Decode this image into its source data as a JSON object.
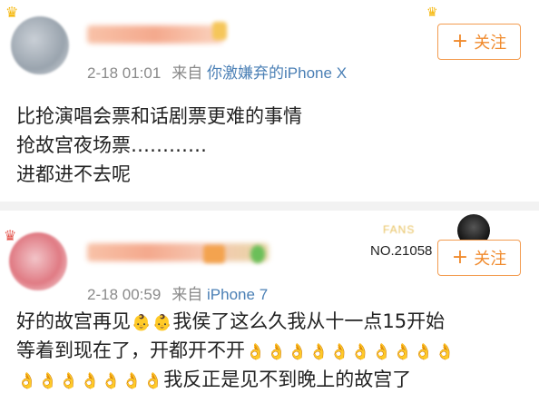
{
  "posts": [
    {
      "timestamp": "2-18 01:01",
      "source_prefix": "来自",
      "source": "你激嫌弃的iPhone X",
      "follow_label": "关注",
      "follow_icon": "+",
      "lines": [
        "比抢演唱会票和话剧票更难的事情",
        "抢故宫夜场票…………",
        "进都进不去呢"
      ]
    },
    {
      "timestamp": "2-18 00:59",
      "source_prefix": "来自",
      "source": "iPhone 7",
      "follow_label": "关注",
      "follow_icon": "+",
      "fans_badge": "FANS",
      "fans_number": "NO.21058",
      "lines": [
        {
          "text_a": "好的故宫再见",
          "text_b": "我侯了这么久我从十一点15开始"
        },
        "等着到现在了，开都开不开",
        "我反正是见不到晚上的故宫了"
      ]
    }
  ],
  "emoji": {
    "ok_hand": "👌",
    "kid": "👶"
  },
  "colors": {
    "follow": "#f08a2c",
    "source_link": "#4a7fb5",
    "meta": "#8a8a8a",
    "text": "#222222"
  }
}
